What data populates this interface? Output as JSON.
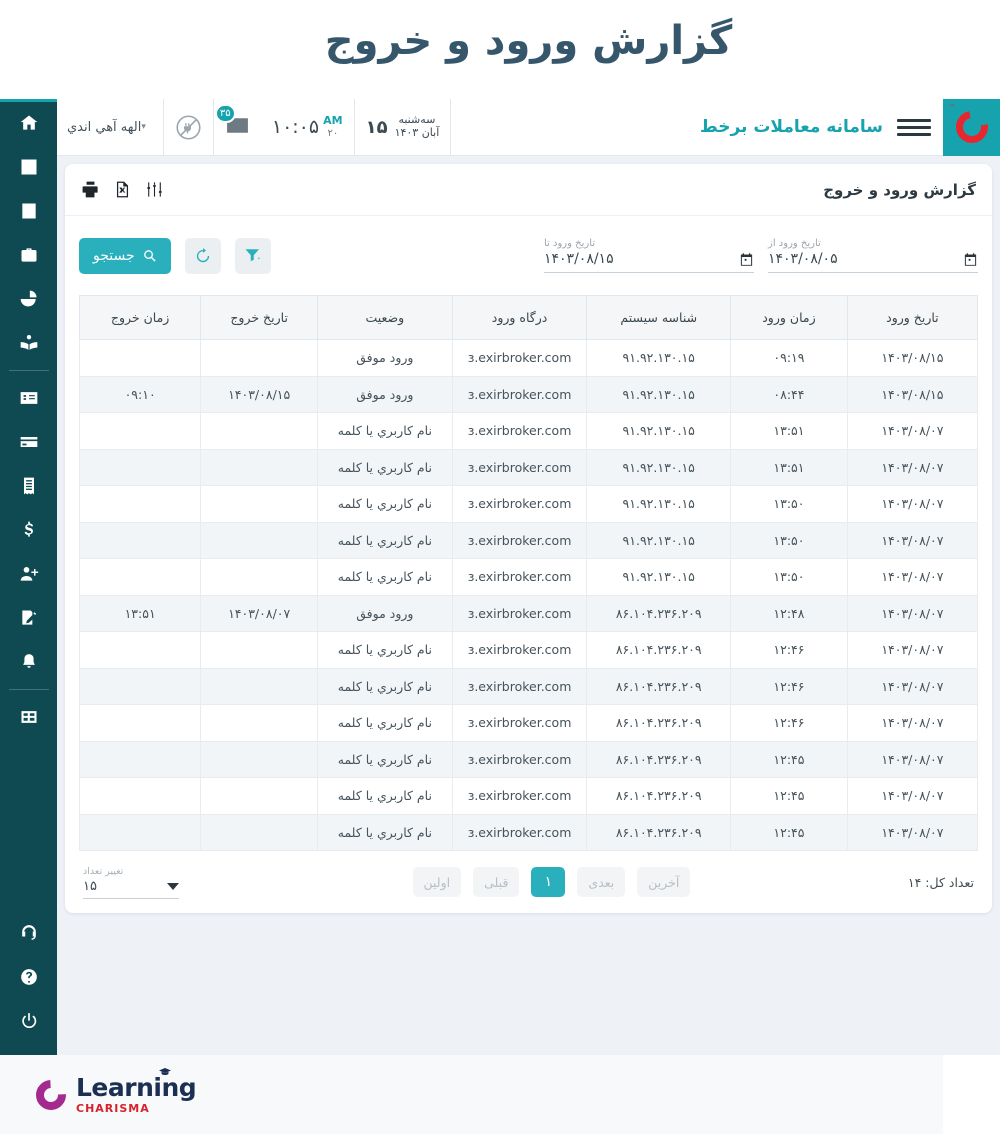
{
  "page": {
    "title": "گزارش ورود و خروج"
  },
  "topbar": {
    "brand": "سامانه معاملات برخط",
    "logo_icon": "charisma-c-logo",
    "menu_icon": "hamburger-menu-icon",
    "wallet_icon": "wallet-icon",
    "date": {
      "day_number": "۱۵",
      "weekday": "سه‌شنبه",
      "month_year": "آبان ۱۴۰۳"
    },
    "time": {
      "clock": "۱۰:۰۵",
      "ampm": "AM",
      "seconds": "۲۰"
    },
    "mail": {
      "icon": "envelope-icon",
      "badge": "۳۵"
    },
    "connection": {
      "icon": "plug-disconnected-icon"
    },
    "user": {
      "name": "الهه آهي اندي",
      "caret": "▾",
      "avatar_icon": "user-avatar-icon"
    }
  },
  "sidebar": {
    "items": [
      {
        "icon": "home-icon",
        "name": "sidebar-item-home"
      },
      {
        "icon": "list-icon",
        "name": "sidebar-item-orders"
      },
      {
        "icon": "book-icon",
        "name": "sidebar-item-reports"
      },
      {
        "icon": "briefcase-icon",
        "name": "sidebar-item-portfolio"
      },
      {
        "icon": "pie-chart-icon",
        "name": "sidebar-item-analytics"
      },
      {
        "icon": "book-reader-icon",
        "name": "sidebar-item-education"
      },
      {
        "icon": "id-card-icon",
        "name": "sidebar-item-profile"
      },
      {
        "icon": "credit-card-icon",
        "name": "sidebar-item-payments"
      },
      {
        "icon": "receipt-icon",
        "name": "sidebar-item-invoices"
      },
      {
        "icon": "dollar-icon",
        "name": "sidebar-item-funds"
      },
      {
        "icon": "user-plus-icon",
        "name": "sidebar-item-register"
      },
      {
        "icon": "edit-document-icon",
        "name": "sidebar-item-requests"
      },
      {
        "icon": "bell-icon",
        "name": "sidebar-item-notifications"
      },
      {
        "icon": "grid-icon",
        "name": "sidebar-item-apps"
      },
      {
        "icon": "headset-icon",
        "name": "sidebar-item-support"
      },
      {
        "icon": "question-icon",
        "name": "sidebar-item-help"
      },
      {
        "icon": "power-icon",
        "name": "sidebar-item-logout"
      }
    ]
  },
  "card": {
    "title": "گزارش ورود و خروج",
    "tools": [
      {
        "icon": "sliders-settings-icon",
        "name": "column-settings-button"
      },
      {
        "icon": "excel-export-icon",
        "name": "excel-export-button"
      },
      {
        "icon": "printer-icon",
        "name": "print-button"
      }
    ]
  },
  "filters": {
    "date_from": {
      "label": "تاریخ ورود از",
      "value": "۱۴۰۳/۰۸/۰۵",
      "icon": "calendar-icon"
    },
    "date_to": {
      "label": "تاریخ ورود تا",
      "value": "۱۴۰۳/۰۸/۱۵",
      "icon": "calendar-icon"
    },
    "search_button": {
      "label": "جستجو",
      "icon": "search-icon"
    },
    "refresh_button": {
      "icon": "refresh-icon"
    },
    "filter_button": {
      "icon": "funnel-filter-icon"
    }
  },
  "table": {
    "columns": [
      "تاریخ ورود",
      "زمان ورود",
      "شناسه سیستم",
      "درگاه ورود",
      "وضعیت",
      "تاریخ خروج",
      "زمان خروج"
    ],
    "rows": [
      [
        "۱۴۰۳/۰۸/۱۵",
        "۰۹:۱۹",
        "۹۱.۹۲.۱۳۰.۱۵",
        "ɜ.exirbroker.com",
        "ورود موفق",
        "",
        ""
      ],
      [
        "۱۴۰۳/۰۸/۱۵",
        "۰۸:۴۴",
        "۹۱.۹۲.۱۳۰.۱۵",
        "ɜ.exirbroker.com",
        "ورود موفق",
        "۱۴۰۳/۰۸/۱۵",
        "۰۹:۱۰"
      ],
      [
        "۱۴۰۳/۰۸/۰۷",
        "۱۳:۵۱",
        "۹۱.۹۲.۱۳۰.۱۵",
        "ɜ.exirbroker.com",
        "نام کاربري يا کلمه",
        "",
        ""
      ],
      [
        "۱۴۰۳/۰۸/۰۷",
        "۱۳:۵۱",
        "۹۱.۹۲.۱۳۰.۱۵",
        "ɜ.exirbroker.com",
        "نام کاربري يا کلمه",
        "",
        ""
      ],
      [
        "۱۴۰۳/۰۸/۰۷",
        "۱۳:۵۰",
        "۹۱.۹۲.۱۳۰.۱۵",
        "ɜ.exirbroker.com",
        "نام کاربري يا کلمه",
        "",
        ""
      ],
      [
        "۱۴۰۳/۰۸/۰۷",
        "۱۳:۵۰",
        "۹۱.۹۲.۱۳۰.۱۵",
        "ɜ.exirbroker.com",
        "نام کاربري يا کلمه",
        "",
        ""
      ],
      [
        "۱۴۰۳/۰۸/۰۷",
        "۱۳:۵۰",
        "۹۱.۹۲.۱۳۰.۱۵",
        "ɜ.exirbroker.com",
        "نام کاربري يا کلمه",
        "",
        ""
      ],
      [
        "۱۴۰۳/۰۸/۰۷",
        "۱۲:۴۸",
        "۸۶.۱۰۴.۲۳۶.۲۰۹",
        "ɜ.exirbroker.com",
        "ورود موفق",
        "۱۴۰۳/۰۸/۰۷",
        "۱۳:۵۱"
      ],
      [
        "۱۴۰۳/۰۸/۰۷",
        "۱۲:۴۶",
        "۸۶.۱۰۴.۲۳۶.۲۰۹",
        "ɜ.exirbroker.com",
        "نام کاربري يا کلمه",
        "",
        ""
      ],
      [
        "۱۴۰۳/۰۸/۰۷",
        "۱۲:۴۶",
        "۸۶.۱۰۴.۲۳۶.۲۰۹",
        "ɜ.exirbroker.com",
        "نام کاربري يا کلمه",
        "",
        ""
      ],
      [
        "۱۴۰۳/۰۸/۰۷",
        "۱۲:۴۶",
        "۸۶.۱۰۴.۲۳۶.۲۰۹",
        "ɜ.exirbroker.com",
        "نام کاربري يا کلمه",
        "",
        ""
      ],
      [
        "۱۴۰۳/۰۸/۰۷",
        "۱۲:۴۵",
        "۸۶.۱۰۴.۲۳۶.۲۰۹",
        "ɜ.exirbroker.com",
        "نام کاربري يا کلمه",
        "",
        ""
      ],
      [
        "۱۴۰۳/۰۸/۰۷",
        "۱۲:۴۵",
        "۸۶.۱۰۴.۲۳۶.۲۰۹",
        "ɜ.exirbroker.com",
        "نام کاربري يا کلمه",
        "",
        ""
      ],
      [
        "۱۴۰۳/۰۸/۰۷",
        "۱۲:۴۵",
        "۸۶.۱۰۴.۲۳۶.۲۰۹",
        "ɜ.exirbroker.com",
        "نام کاربري يا کلمه",
        "",
        ""
      ]
    ]
  },
  "pagination": {
    "total_label": "تعداد کل: ۱۴",
    "last": "آخرین",
    "next": "بعدی",
    "current_page": "۱",
    "prev": "قبلی",
    "first": "اولین",
    "per_page_label": "تغییر تعداد",
    "per_page_value": "۱۵"
  },
  "footer": {
    "logo_primary": "Learning",
    "logo_secondary": "CHARISMA",
    "logo_icon": "charisma-learning-logo"
  },
  "colors": {
    "accent_teal": "#2ab0bd",
    "sidebar_dark": "#0f4a52",
    "brand_red": "#e8262d",
    "title_navy": "#35566b",
    "logo_purple": "#a32a8e"
  }
}
